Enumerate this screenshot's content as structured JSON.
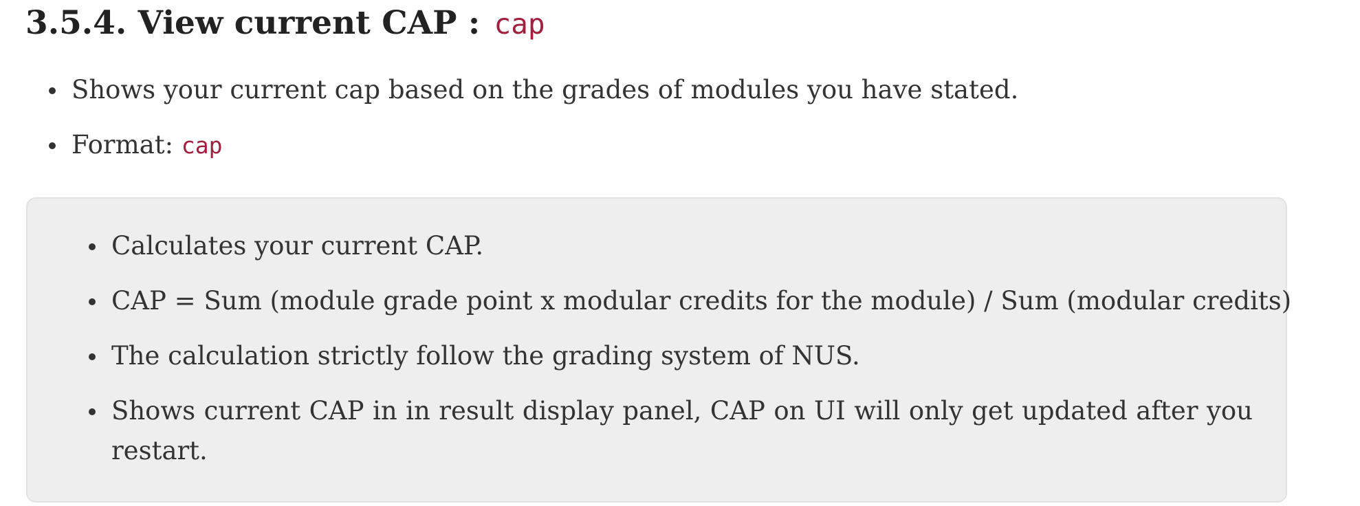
{
  "heading": {
    "number_title": "3.5.4. View current CAP : ",
    "command": "cap"
  },
  "summary_items": [
    {
      "text": "Shows your current cap based on the grades of modules you have stated."
    },
    {
      "label": "Format: ",
      "code": "cap"
    }
  ],
  "note_items": [
    "Calculates your current CAP.",
    "CAP = Sum (module grade point x modular credits for the module) / Sum (modular credits)",
    "The calculation strictly follow the grading system of NUS.",
    "Shows current CAP in in result display panel, CAP on UI will only get updated after you restart."
  ]
}
